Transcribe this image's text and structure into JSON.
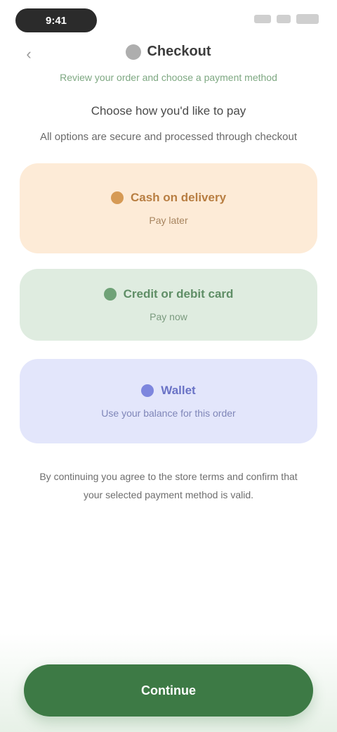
{
  "status_bar": {
    "time": "9:41"
  },
  "header": {
    "title": "Checkout",
    "subtitle": "Review your order and choose a payment method"
  },
  "intro": {
    "line1": "Choose how you'd like to pay",
    "line2": "All options are secure and processed through checkout"
  },
  "cards": [
    {
      "title": "Cash on delivery",
      "subtitle": "Pay later"
    },
    {
      "title": "Credit or debit card",
      "subtitle": "Pay now"
    },
    {
      "title": "Wallet",
      "subtitle": "Use your balance for this order"
    }
  ],
  "footnote": "By continuing you agree to the store terms and confirm that your selected payment method is valid.",
  "primary_button": {
    "label": "Continue"
  },
  "colors": {
    "primary": "#3d7a45",
    "orange_card": "#fdebd7",
    "green_card": "#dfece0",
    "blue_card": "#e3e6fb"
  }
}
